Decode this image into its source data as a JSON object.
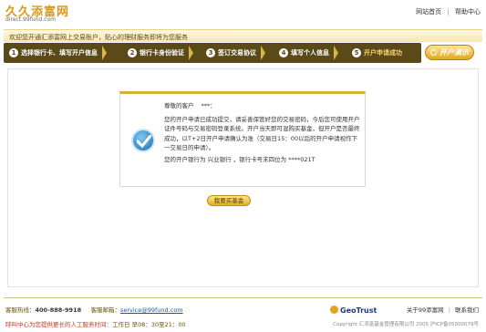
{
  "header": {
    "logo_title": "久久添富网",
    "logo_url": "direct.99fund.com",
    "links": [
      "网站首页",
      "帮助中心"
    ],
    "separator": "|"
  },
  "welcome": {
    "text": "欢迎您开通汇添富网上交易账户，贴心的理财服务即将为您服务"
  },
  "steps": [
    {
      "num": "1",
      "label": "选择银行卡、填写开户信息"
    },
    {
      "num": "2",
      "label": "银行卡身份验证"
    },
    {
      "num": "3",
      "label": "签订交易协议"
    },
    {
      "num": "4",
      "label": "填写个人信息"
    },
    {
      "num": "5",
      "label": "开户申请成功"
    }
  ],
  "demo_button": "开户演示",
  "notice": {
    "greeting": "尊敬的客户",
    "customer_name": "***",
    "greeting_suffix": "：",
    "para1": "您的开户申请已成功提交，请妥善保管好您的交易密码，今后您可使用开户证件号码与交易密码登录系统。开户当天即可混购买基金，但开户是否最终成功，以T+2日开户申请确认为准（交易日15：00以后的开户申请视作下一交易日的申请）。",
    "para2": "您的开户银行为 兴业银行 ，银行卡号末四位为 ****021T"
  },
  "return_button": "我要买基金",
  "footer": {
    "hotline_label": "客服热线：",
    "hotline": "400-888-9918",
    "email_label": "客服邮箱：",
    "email": "service@99fund.com",
    "hours_prefix": "呼叫中心为您提供更长的人工服务时间：",
    "hours": "工作日 早08：30至21：00",
    "geotrust": "GeoTrust",
    "links": [
      "关于99添富网",
      "联系我们"
    ],
    "copyright": "Copyright 汇添富基金管理有限公司 2005 沪ICP备05000079号"
  },
  "colors": {
    "accent_gold": "#d4b33a",
    "step_bar": "#5a4a1a",
    "link_blue": "#1a55b0"
  }
}
